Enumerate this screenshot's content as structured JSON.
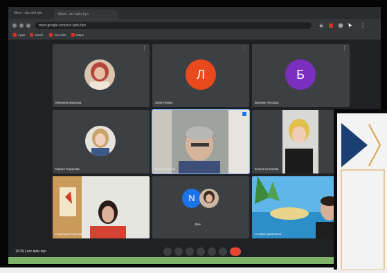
{
  "browser": {
    "left_tab_text": "Meet - abc-def-ghi",
    "tab_title": "Meet - szc-kpfu-hyn",
    "url": "meet.google.com/szc-kpfu-hyn",
    "bookmarks": [
      "Apps",
      "Gmail",
      "YouTube",
      "Maps"
    ]
  },
  "participants": [
    {
      "name": "Ивелина Иванова",
      "kind": "photo"
    },
    {
      "name": "Лили Пеева",
      "kind": "letter",
      "initial": "Л",
      "color": "#e8491d"
    },
    {
      "name": "Биляна Петрова",
      "kind": "letter",
      "initial": "Б",
      "color": "#7b2fbf"
    },
    {
      "name": "Мария Тодорова",
      "kind": "photo"
    },
    {
      "name": "Петър Петров",
      "kind": "video",
      "active": true
    },
    {
      "name": "Елена Стоянова",
      "kind": "video"
    },
    {
      "name": "Надежда Рашкова",
      "kind": "video"
    },
    {
      "name": "Вие",
      "kind": "letter-pair",
      "initial": "N",
      "color": "#1a73e8"
    },
    {
      "name": "Стефан Димитров",
      "kind": "video"
    }
  ],
  "controls": {
    "meeting_info": "10:26 | szc-kpfu-hyn"
  },
  "colors": {
    "meet_bg": "#202124",
    "tile_bg": "#3c4043",
    "hangup": "#ea4335",
    "card_arrow": "#1b3f73",
    "card_border": "#d9a24a"
  }
}
